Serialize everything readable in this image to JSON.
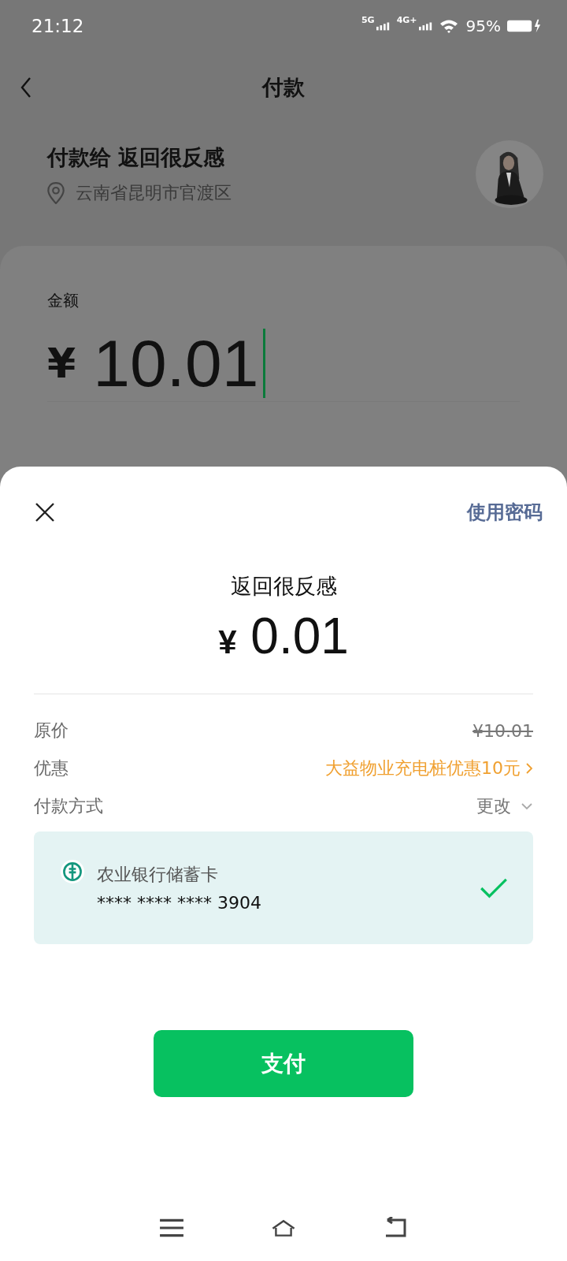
{
  "status_bar": {
    "time": "21:12",
    "signal_1": "5G",
    "signal_2": "4G+",
    "battery": "95%"
  },
  "header": {
    "title": "付款"
  },
  "payee": {
    "label": "付款给 返回很反感",
    "location": "云南省昆明市官渡区"
  },
  "amount_card": {
    "label": "金额",
    "currency": "¥",
    "value": "10.01",
    "focused": true
  },
  "sheet": {
    "password_link": "使用密码",
    "payee_name": "返回很反感",
    "currency": "¥",
    "amount": "0.01",
    "rows": [
      {
        "label": "原价",
        "value": "¥10.01",
        "kind": "struck"
      },
      {
        "label": "优惠",
        "value": "大益物业充电桩优惠10元",
        "kind": "link"
      },
      {
        "label": "付款方式",
        "value": "更改",
        "kind": "dropdown"
      }
    ],
    "card": {
      "name": "农业银行储蓄卡",
      "number": "**** **** **** 3904",
      "selected": true
    },
    "pay_button": "支付"
  }
}
